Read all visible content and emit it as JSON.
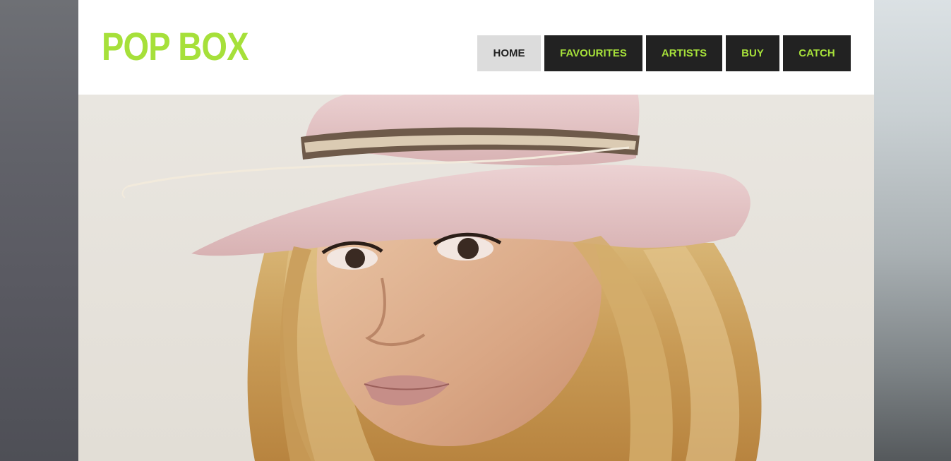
{
  "site": {
    "logo": "POP BOX"
  },
  "nav": {
    "items": [
      {
        "label": "HOME",
        "active": true
      },
      {
        "label": "FAVOURITES",
        "active": false
      },
      {
        "label": "ARTISTS",
        "active": false
      },
      {
        "label": "BUY",
        "active": false
      },
      {
        "label": "CATCH",
        "active": false
      }
    ]
  },
  "colors": {
    "accent": "#a6e03a",
    "nav_bg": "#222222",
    "nav_active_bg": "#dcdcdc",
    "nav_active_text": "#222222"
  },
  "hero": {
    "image": "portrait-woman-pink-hat"
  }
}
